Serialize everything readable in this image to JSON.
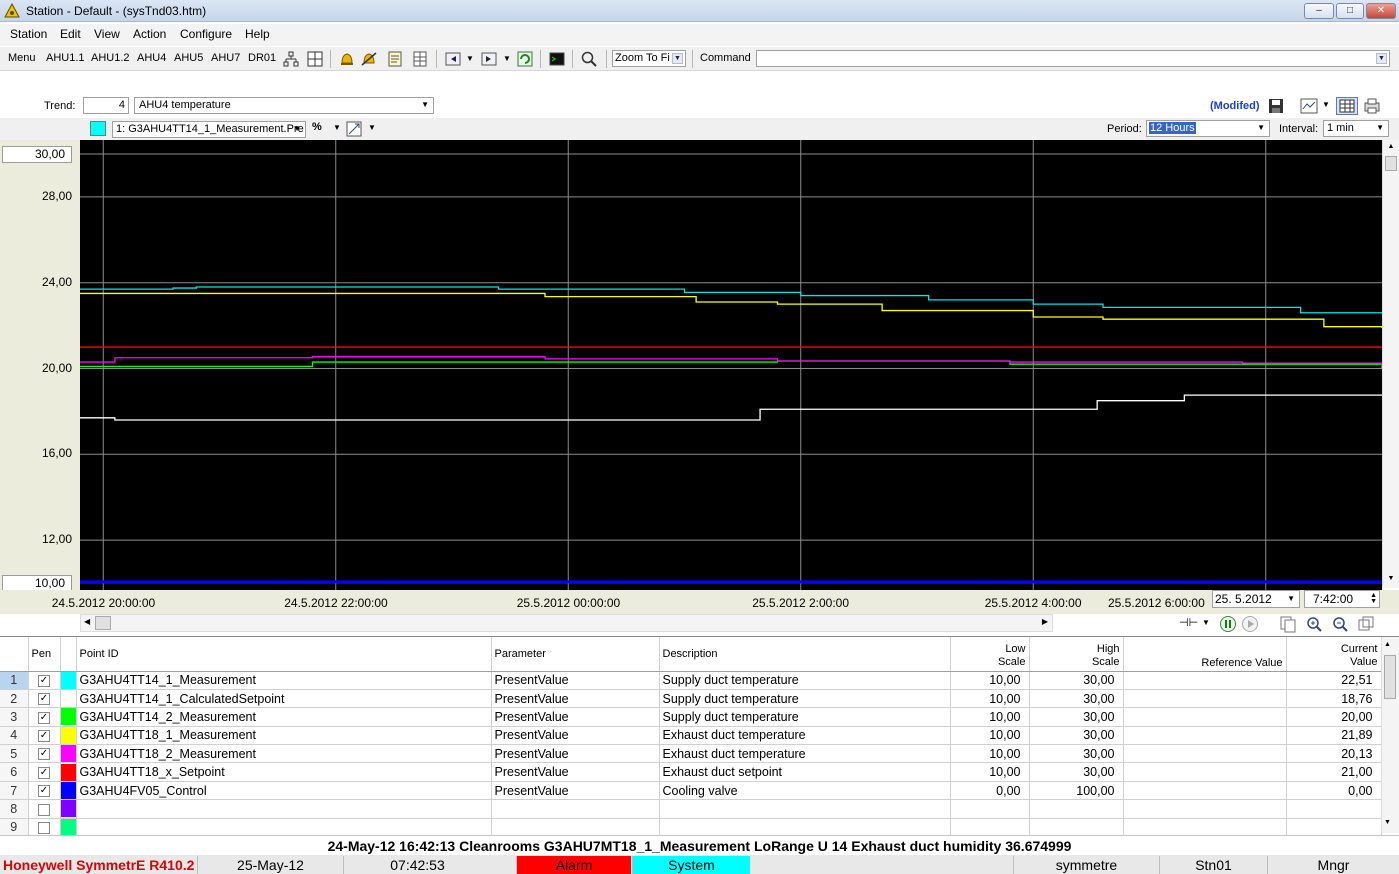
{
  "window": {
    "title": "Station - Default - (sysTnd03.htm)",
    "min": "–",
    "max": "□",
    "close": "✕"
  },
  "menu": [
    "Station",
    "Edit",
    "View",
    "Action",
    "Configure",
    "Help"
  ],
  "toolbar": {
    "buttons": [
      "Menu",
      "AHU1.1",
      "AHU1.2",
      "AHU4",
      "AHU5",
      "AHU7",
      "DR01"
    ],
    "zoom": "Zoom To Fi",
    "command_label": "Command",
    "command_value": ""
  },
  "trend": {
    "label": "Trend:",
    "number": "4",
    "name": "AHU4 temperature",
    "modified": "(Modifed)",
    "pen_select": "1: G3AHU4TT14_1_Measurement.Pre",
    "period_label": "Period:",
    "period": "12 Hours",
    "interval_label": "Interval:",
    "interval": "1 min",
    "date_field": "25.  5.2012",
    "time_field": "7:42:00"
  },
  "chart_data": {
    "type": "line",
    "ylim": [
      10,
      30
    ],
    "y_ticks": [
      "30,00",
      "28,00",
      "24,00",
      "20,00",
      "16,00",
      "12,00",
      "10,00"
    ],
    "y_tick_values": [
      30,
      28,
      24,
      20,
      16,
      12,
      10
    ],
    "x_ticks": [
      "24.5.2012 20:00:00",
      "24.5.2012 22:00:00",
      "25.5.2012 00:00:00",
      "25.5.2012 2:00:00",
      "25.5.2012 4:00:00",
      "25.5.2012 6:00:00"
    ],
    "x_tick_hours": [
      0.2,
      2.2,
      4.2,
      6.2,
      8.2,
      10.2
    ],
    "x_range_hours": [
      0,
      11.2
    ],
    "grid": true,
    "series": [
      {
        "color": "#00e5e5",
        "x": [
          0,
          0.6,
          0.8,
          1.0,
          3.6,
          5.2,
          6.2,
          7.3,
          8.2,
          8.8,
          10.5,
          11.2
        ],
        "y": [
          23.7,
          23.7,
          23.75,
          23.8,
          23.7,
          23.55,
          23.4,
          23.2,
          23.0,
          22.85,
          22.6,
          22.55
        ]
      },
      {
        "color": "#ffffff",
        "x": [
          0,
          0.3,
          5.8,
          5.85,
          8.7,
          8.75,
          9.45,
          9.5,
          11.2
        ],
        "y": [
          17.7,
          17.6,
          17.6,
          18.1,
          18.1,
          18.5,
          18.5,
          18.76,
          18.76
        ]
      },
      {
        "color": "#00ff00",
        "x": [
          0,
          2.0,
          6.0,
          8.0,
          11.2
        ],
        "y": [
          20.1,
          20.3,
          20.35,
          20.2,
          20.0
        ]
      },
      {
        "color": "#ffff00",
        "x": [
          0,
          1.0,
          4.0,
          5.3,
          6.0,
          6.9,
          8.2,
          8.8,
          10.7,
          11.2
        ],
        "y": [
          23.5,
          23.5,
          23.35,
          23.1,
          23.0,
          22.7,
          22.4,
          22.3,
          21.95,
          21.89
        ]
      },
      {
        "color": "#ff00ff",
        "x": [
          0,
          0.3,
          2.0,
          4.0,
          6.0,
          8.0,
          10.0,
          11.2
        ],
        "y": [
          20.3,
          20.5,
          20.55,
          20.45,
          20.35,
          20.3,
          20.25,
          20.13
        ]
      },
      {
        "color": "#ff0000",
        "x": [
          0,
          11.2
        ],
        "y": [
          21.0,
          21.0
        ]
      },
      {
        "color": "#0000ff",
        "x": [
          0,
          11.2
        ],
        "y": [
          10.05,
          10.05
        ]
      }
    ]
  },
  "grid": {
    "headers": {
      "pen": "Pen",
      "point_id": "Point ID",
      "parameter": "Parameter",
      "description": "Description",
      "low_scale": "Low Scale",
      "high_scale": "High Scale",
      "reference": "Reference Value",
      "current": "Current Value"
    },
    "rows": [
      {
        "n": "1",
        "checked": true,
        "color": "#00ffff",
        "point_id": "G3AHU4TT14_1_Measurement",
        "parameter": "PresentValue",
        "description": "Supply duct temperature",
        "low": "10,00",
        "high": "30,00",
        "ref": "",
        "current": "22,51"
      },
      {
        "n": "2",
        "checked": true,
        "color": "#ffffff",
        "point_id": "G3AHU4TT14_1_CalculatedSetpoint",
        "parameter": "PresentValue",
        "description": "Supply duct temperature",
        "low": "10,00",
        "high": "30,00",
        "ref": "",
        "current": "18,76"
      },
      {
        "n": "3",
        "checked": true,
        "color": "#00ff00",
        "point_id": "G3AHU4TT14_2_Measurement",
        "parameter": "PresentValue",
        "description": "Supply duct temperature",
        "low": "10,00",
        "high": "30,00",
        "ref": "",
        "current": "20,00"
      },
      {
        "n": "4",
        "checked": true,
        "color": "#ffff00",
        "point_id": "G3AHU4TT18_1_Measurement",
        "parameter": "PresentValue",
        "description": "Exhaust duct temperature",
        "low": "10,00",
        "high": "30,00",
        "ref": "",
        "current": "21,89"
      },
      {
        "n": "5",
        "checked": true,
        "color": "#ff00ff",
        "point_id": "G3AHU4TT18_2_Measurement",
        "parameter": "PresentValue",
        "description": "Exhaust duct temperature",
        "low": "10,00",
        "high": "30,00",
        "ref": "",
        "current": "20,13"
      },
      {
        "n": "6",
        "checked": true,
        "color": "#ff0000",
        "point_id": "G3AHU4TT18_x_Setpoint",
        "parameter": "PresentValue",
        "description": "Exhaust duct setpoint",
        "low": "10,00",
        "high": "30,00",
        "ref": "",
        "current": "21,00"
      },
      {
        "n": "7",
        "checked": true,
        "color": "#0000ff",
        "point_id": "G3AHU4FV05_Control",
        "parameter": "PresentValue",
        "description": "Cooling valve",
        "low": "0,00",
        "high": "100,00",
        "ref": "",
        "current": "0,00"
      },
      {
        "n": "8",
        "checked": false,
        "color": "#8000ff",
        "point_id": "",
        "parameter": "",
        "description": "",
        "low": "",
        "high": "",
        "ref": "",
        "current": ""
      },
      {
        "n": "9",
        "checked": false,
        "color": "#00ff80",
        "point_id": "",
        "parameter": "",
        "description": "",
        "low": "",
        "high": "",
        "ref": "",
        "current": ""
      }
    ]
  },
  "status_message": "24-May-12  16:42:13  Cleanrooms   G3AHU7MT18_1_Measurement   LoRange   U 14 Exhaust duct humidity   36.674999",
  "statusbar": {
    "product": "Honeywell SymmetrE R410.2",
    "date": "25-May-12",
    "time": "07:42:53",
    "alarm": "Alarm",
    "system": "System",
    "server": "symmetre",
    "station": "Stn01",
    "role": "Mngr"
  }
}
